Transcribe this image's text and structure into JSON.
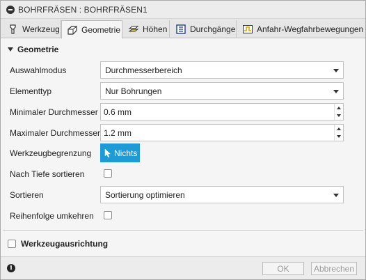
{
  "window": {
    "title": "BOHRFRÄSEN : BOHRFRÄSEN1"
  },
  "tabs": [
    {
      "label": "Werkzeug",
      "icon": "tool-icon"
    },
    {
      "label": "Geometrie",
      "icon": "geometry-icon",
      "active": true
    },
    {
      "label": "Höhen",
      "icon": "heights-icon"
    },
    {
      "label": "Durchgänge",
      "icon": "passes-icon"
    },
    {
      "label": "Anfahr-Wegfahrbewegungen",
      "icon": "linking-icon"
    }
  ],
  "geometry": {
    "section_title": "Geometrie",
    "selection_mode": {
      "label": "Auswahlmodus",
      "value": "Durchmesserbereich"
    },
    "element_type": {
      "label": "Elementtyp",
      "value": "Nur Bohrungen"
    },
    "min_diameter": {
      "label": "Minimaler Durchmesser",
      "value": "0.6 mm"
    },
    "max_diameter": {
      "label": "Maximaler Durchmesser",
      "value": "1.2 mm"
    },
    "tool_boundary": {
      "label": "Werkzeugbegrenzung",
      "button": "Nichts"
    },
    "sort_by_depth": {
      "label": "Nach Tiefe sortieren",
      "checked": false
    },
    "sort": {
      "label": "Sortieren",
      "value": "Sortierung optimieren"
    },
    "reverse_order": {
      "label": "Reihenfolge umkehren",
      "checked": false
    }
  },
  "tool_orientation": {
    "label": "Werkzeugausrichtung",
    "checked": false
  },
  "footer": {
    "ok": "OK",
    "cancel": "Abbrechen"
  },
  "colors": {
    "accent": "#1e9ad6"
  }
}
